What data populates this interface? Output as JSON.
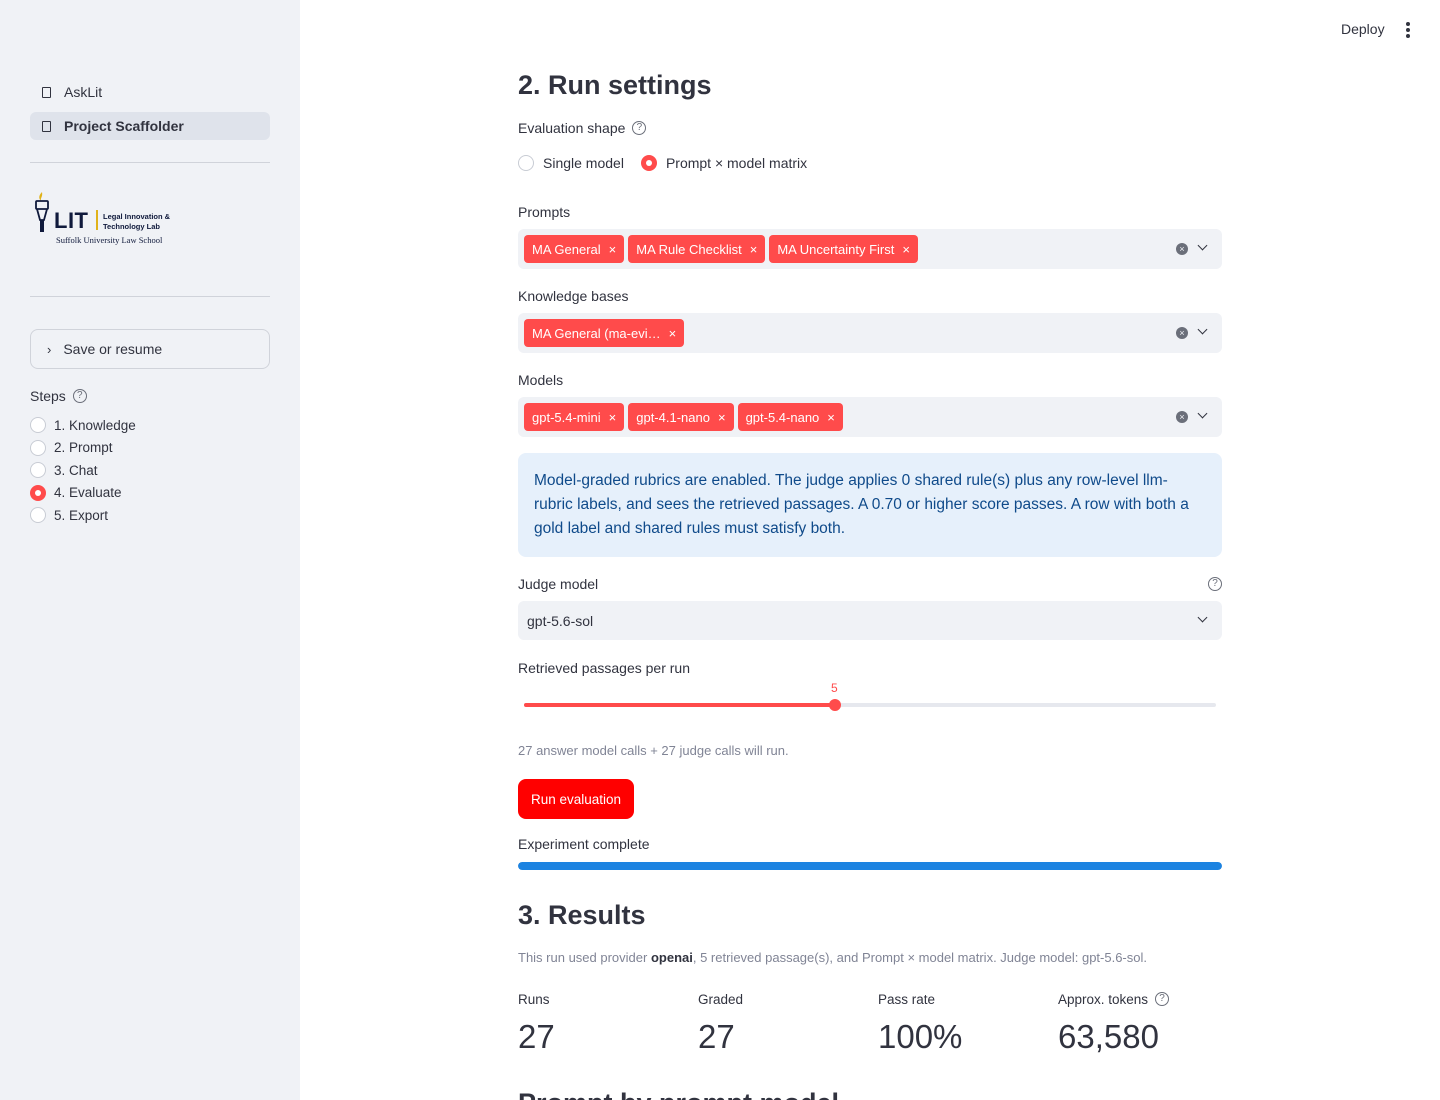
{
  "nav": {
    "items": [
      {
        "label": "AskLit",
        "active": false
      },
      {
        "label": "Project Scaffolder",
        "active": true
      }
    ]
  },
  "logo": {
    "mark": "LIT",
    "line1": "Legal Innovation &",
    "line2": "Technology Lab",
    "sub": "Suffolk University Law School"
  },
  "sidebar": {
    "expander_label": "Save or resume",
    "steps_label": "Steps",
    "steps": [
      {
        "label": "1. Knowledge",
        "selected": false
      },
      {
        "label": "2. Prompt",
        "selected": false
      },
      {
        "label": "3. Chat",
        "selected": false
      },
      {
        "label": "4. Evaluate",
        "selected": true
      },
      {
        "label": "5. Export",
        "selected": false
      }
    ]
  },
  "header": {
    "deploy_label": "Deploy"
  },
  "run_settings": {
    "title": "2. Run settings",
    "shape_label": "Evaluation shape",
    "shape_options": [
      {
        "label": "Single model",
        "selected": false
      },
      {
        "label": "Prompt × model matrix",
        "selected": true
      }
    ],
    "prompts_label": "Prompts",
    "prompts": [
      "MA General",
      "MA Rule Checklist",
      "MA Uncertainty First"
    ],
    "kb_label": "Knowledge bases",
    "knowledge_bases": [
      "MA General (ma-evi…"
    ],
    "models_label": "Models",
    "models": [
      "gpt-5.4-mini",
      "gpt-4.1-nano",
      "gpt-5.4-nano"
    ],
    "info_text": "Model-graded rubrics are enabled. The judge applies 0 shared rule(s) plus any row-level llm-rubric labels, and sees the retrieved passages. A 0.70 or higher score passes. A row with both a gold label and shared rules must satisfy both.",
    "judge_label": "Judge model",
    "judge_value": "gpt-5.6-sol",
    "slider_label": "Retrieved passages per run",
    "slider_value": "5",
    "slider_fraction": 0.45,
    "calls_caption": "27 answer model calls + 27 judge calls will run.",
    "run_button": "Run evaluation",
    "progress_label": "Experiment complete",
    "progress_value": 1.0
  },
  "results": {
    "title": "3. Results",
    "caption_pre": "This run used provider ",
    "provider": "openai",
    "caption_post": ", 5 retrieved passage(s), and Prompt × model matrix. Judge model: gpt-5.6-sol.",
    "metrics": [
      {
        "label": "Runs",
        "value": "27",
        "help": false
      },
      {
        "label": "Graded",
        "value": "27",
        "help": false
      },
      {
        "label": "Pass rate",
        "value": "100%",
        "help": false
      },
      {
        "label": "Approx. tokens",
        "value": "63,580",
        "help": true
      }
    ],
    "next_heading": "Prompt by prompt model"
  },
  "colors": {
    "accent": "#ff4b4b",
    "button": "#ff0000",
    "progress": "#1c83e1",
    "info_bg": "#e6f0fb",
    "info_text": "#0f4a8a"
  }
}
